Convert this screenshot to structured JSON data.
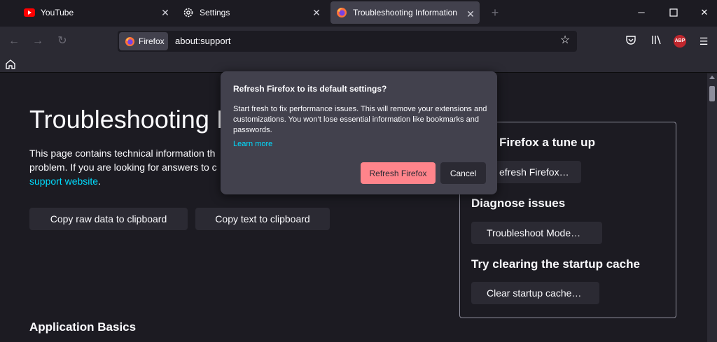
{
  "tabs": [
    {
      "label": "YouTube",
      "icon": "youtube-icon",
      "active": false
    },
    {
      "label": "Settings",
      "icon": "gear-icon",
      "active": false
    },
    {
      "label": "Troubleshooting Information",
      "icon": "firefox-icon",
      "active": true
    }
  ],
  "navbar": {
    "identity_label": "Firefox",
    "url": "about:support",
    "abp_badge": "ABP"
  },
  "page": {
    "title": "Troubleshooting In",
    "intro_text": "This page contains technical information th problem. If you are looking for answers to c",
    "intro_link": "support website",
    "intro_link_tail": ".",
    "copy_raw_label": "Copy raw data to clipboard",
    "copy_text_label": "Copy text to clipboard",
    "app_basics_heading": "Application Basics"
  },
  "side_panel": {
    "tuneup_heading": "Firefox a tune up",
    "refresh_button": "efresh Firefox…",
    "diagnose_heading": "Diagnose issues",
    "troubleshoot_button": "Troubleshoot Mode…",
    "cache_heading": "Try clearing the startup cache",
    "clear_cache_button": "Clear startup cache…"
  },
  "dialog": {
    "title": "Refresh Firefox to its default settings?",
    "body": "Start fresh to fix performance issues. This will remove your extensions and customizations. You won’t lose essential information like bookmarks and passwords.",
    "learn_more": "Learn more",
    "primary_label": "Refresh Firefox",
    "cancel_label": "Cancel"
  },
  "colors": {
    "background": "#1c1b22",
    "surface": "#2b2a33",
    "dialog": "#42414d",
    "accent_link": "#00ddff",
    "primary_button": "#ff848b"
  }
}
